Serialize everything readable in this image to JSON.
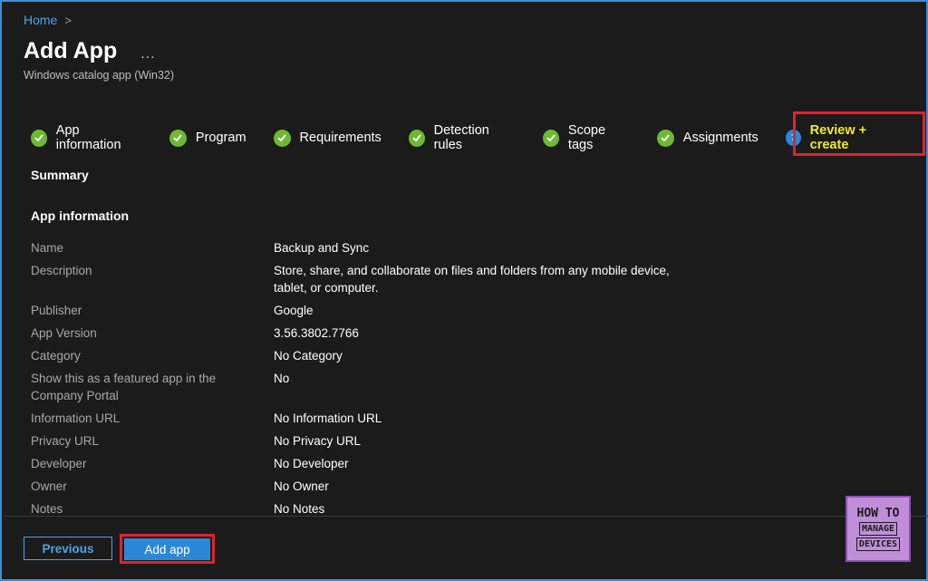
{
  "breadcrumb": {
    "home": "Home",
    "separator": ">"
  },
  "header": {
    "title": "Add App",
    "more": "...",
    "subtitle": "Windows catalog app (Win32)"
  },
  "steps": [
    {
      "label": "App information",
      "status": "complete"
    },
    {
      "label": "Program",
      "status": "complete"
    },
    {
      "label": "Requirements",
      "status": "complete"
    },
    {
      "label": "Detection rules",
      "status": "complete"
    },
    {
      "label": "Scope tags",
      "status": "complete"
    },
    {
      "label": "Assignments",
      "status": "complete"
    },
    {
      "label": "Review + create",
      "status": "current",
      "number": "7"
    }
  ],
  "summary": {
    "title": "Summary",
    "section_title": "App information",
    "rows": [
      {
        "key": "Name",
        "value": "Backup and Sync"
      },
      {
        "key": "Description",
        "value": "Store, share, and collaborate on files and folders from any mobile device,",
        "value2": "tablet, or computer."
      },
      {
        "key": "Publisher",
        "value": "Google"
      },
      {
        "key": "App Version",
        "value": "3.56.3802.7766"
      },
      {
        "key": "Category",
        "value": "No Category"
      },
      {
        "key": "Show this as a featured app in the",
        "key2": "Company Portal",
        "value": "No"
      },
      {
        "key": "Information URL",
        "value": "No Information URL"
      },
      {
        "key": "Privacy URL",
        "value": "No Privacy URL"
      },
      {
        "key": "Developer",
        "value": "No Developer"
      },
      {
        "key": "Owner",
        "value": "No Owner"
      },
      {
        "key": "Notes",
        "value": "No Notes"
      }
    ]
  },
  "footer": {
    "previous": "Previous",
    "add": "Add app"
  },
  "logo": {
    "line1": "HOW TO",
    "line2": "MANAGE",
    "line3": "DEVICES"
  },
  "colors": {
    "accent": "#2b88d8",
    "check": "#6cba2f",
    "highlight": "#e0232e",
    "current_step": "#f2ea29"
  }
}
